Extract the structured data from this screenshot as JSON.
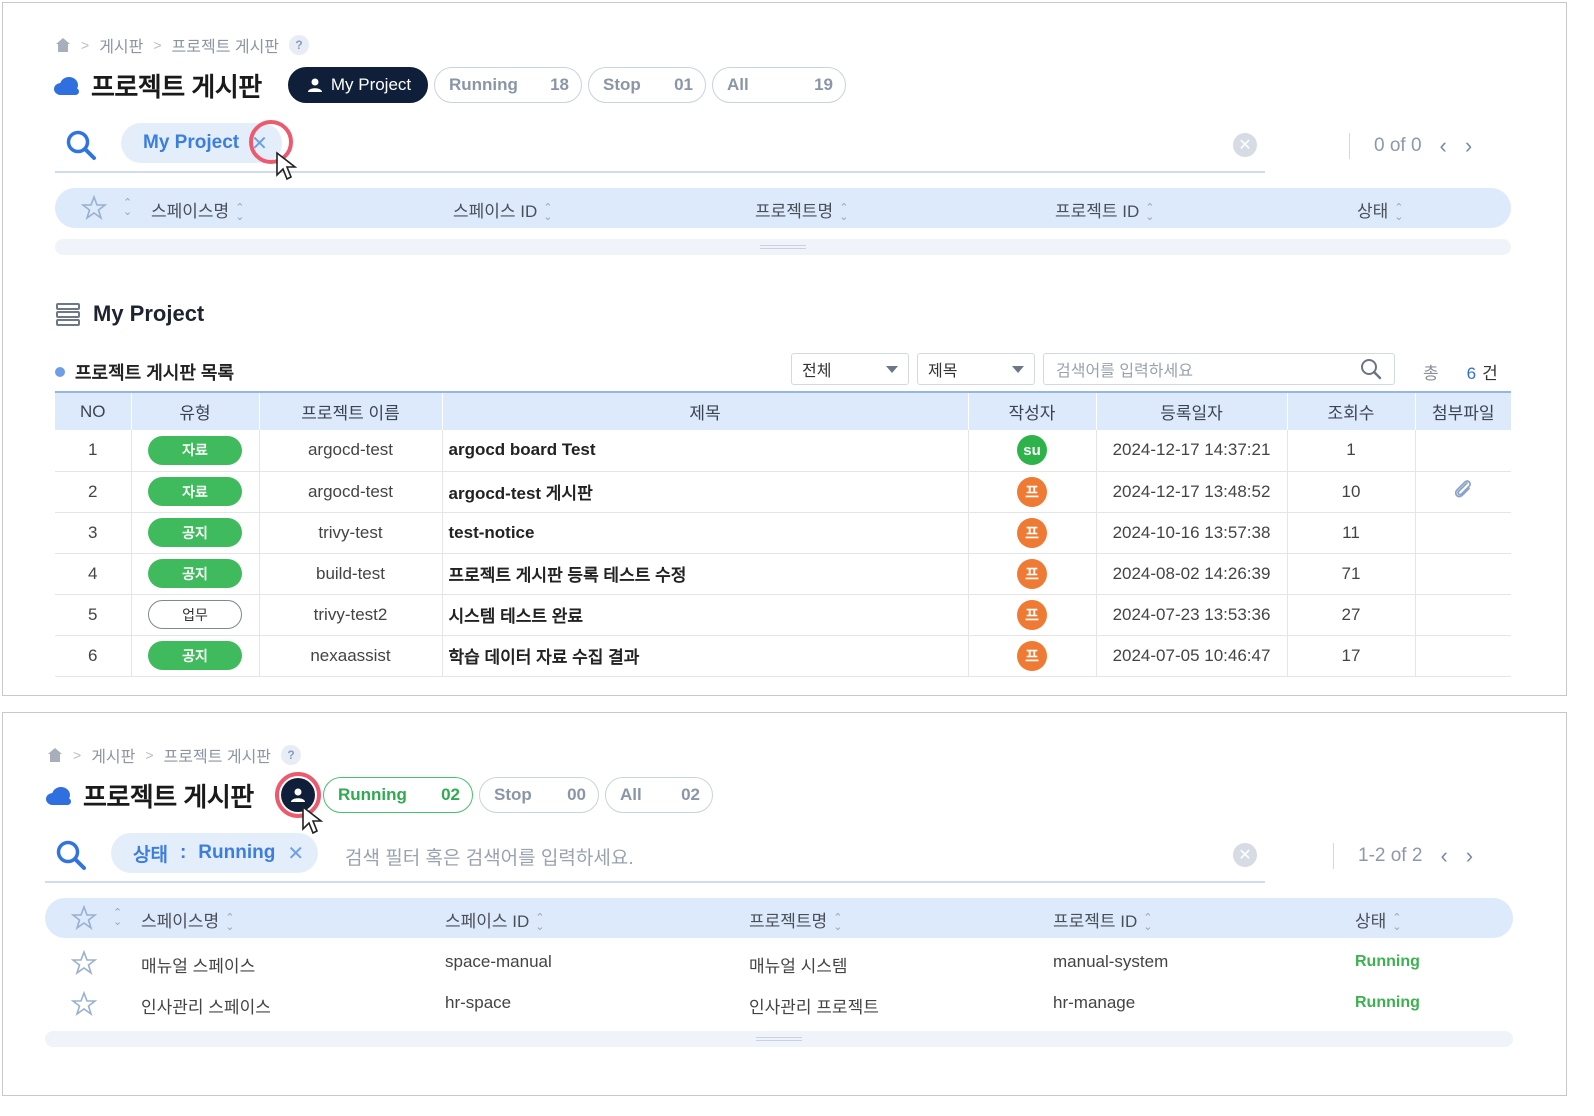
{
  "breadcrumb": {
    "items": [
      "게시판",
      "프로젝트 게시판"
    ],
    "help": "?"
  },
  "page_title": "프로젝트 게시판",
  "panel1": {
    "filters": [
      {
        "label": "My Project",
        "active": true
      },
      {
        "label": "Running",
        "count": "18"
      },
      {
        "label": "Stop",
        "count": "01"
      },
      {
        "label": "All",
        "count": "19"
      }
    ],
    "search_chip": "My Project",
    "pager_text": "0 of 0",
    "columns": [
      "스페이스명",
      "스페이스 ID",
      "프로젝트명",
      "프로젝트 ID",
      "상태"
    ],
    "section_title": "My Project",
    "board_title": "프로젝트 게시판 목록",
    "select1": "전체",
    "select2": "제목",
    "keyword_placeholder": "검색어를 입력하세요",
    "total_label": "총",
    "total_count": "6",
    "total_unit": "건",
    "table_headers": [
      "NO",
      "유형",
      "프로젝트 이름",
      "제목",
      "작성자",
      "등록일자",
      "조회수",
      "첨부파일"
    ],
    "rows": [
      {
        "no": "1",
        "type": "자료",
        "type_style": "green",
        "project": "argocd-test",
        "title": "argocd board Test",
        "author": "su",
        "author_color": "#2db34a",
        "date": "2024-12-17 14:37:21",
        "views": "1",
        "attach": false
      },
      {
        "no": "2",
        "type": "자료",
        "type_style": "green",
        "project": "argocd-test",
        "title": "argocd-test 게시판",
        "author": "프",
        "author_color": "#ef7a33",
        "date": "2024-12-17 13:48:52",
        "views": "10",
        "attach": true
      },
      {
        "no": "3",
        "type": "공지",
        "type_style": "green",
        "project": "trivy-test",
        "title": "test-notice",
        "author": "프",
        "author_color": "#ef7a33",
        "date": "2024-10-16 13:57:38",
        "views": "11",
        "attach": false
      },
      {
        "no": "4",
        "type": "공지",
        "type_style": "green",
        "project": "build-test",
        "title": "프로젝트 게시판 등록 테스트 수정",
        "author": "프",
        "author_color": "#ef7a33",
        "date": "2024-08-02 14:26:39",
        "views": "71",
        "attach": false
      },
      {
        "no": "5",
        "type": "업무",
        "type_style": "outline",
        "project": "trivy-test2",
        "title": "시스템 테스트 완료",
        "author": "프",
        "author_color": "#ef7a33",
        "date": "2024-07-23 13:53:36",
        "views": "27",
        "attach": false
      },
      {
        "no": "6",
        "type": "공지",
        "type_style": "green",
        "project": "nexaassist",
        "title": "학습 데이터 자료 수집 결과",
        "author": "프",
        "author_color": "#ef7a33",
        "date": "2024-07-05 10:46:47",
        "views": "17",
        "attach": false
      }
    ]
  },
  "panel2": {
    "filters": [
      {
        "label": "Running",
        "count": "02",
        "active": true
      },
      {
        "label": "Stop",
        "count": "00"
      },
      {
        "label": "All",
        "count": "02"
      }
    ],
    "chip_key": "상태",
    "chip_sep": ":",
    "chip_value": "Running",
    "search_placeholder": "검색 필터 혹은 검색어를 입력하세요.",
    "pager_text": "1-2 of 2",
    "columns": [
      "스페이스명",
      "스페이스 ID",
      "프로젝트명",
      "프로젝트 ID",
      "상태"
    ],
    "rows": [
      {
        "space_name": "매뉴얼 스페이스",
        "space_id": "space-manual",
        "project_name": "매뉴얼 시스템",
        "project_id": "manual-system",
        "status": "Running"
      },
      {
        "space_name": "인사관리 스페이스",
        "space_id": "hr-space",
        "project_name": "인사관리 프로젝트",
        "project_id": "hr-manage",
        "status": "Running"
      }
    ]
  },
  "colors": {
    "accent_blue": "#3c7ee0",
    "running_green": "#3bb24f",
    "dark_navy": "#0f1f3a",
    "highlight_red": "#ec5a6e"
  }
}
